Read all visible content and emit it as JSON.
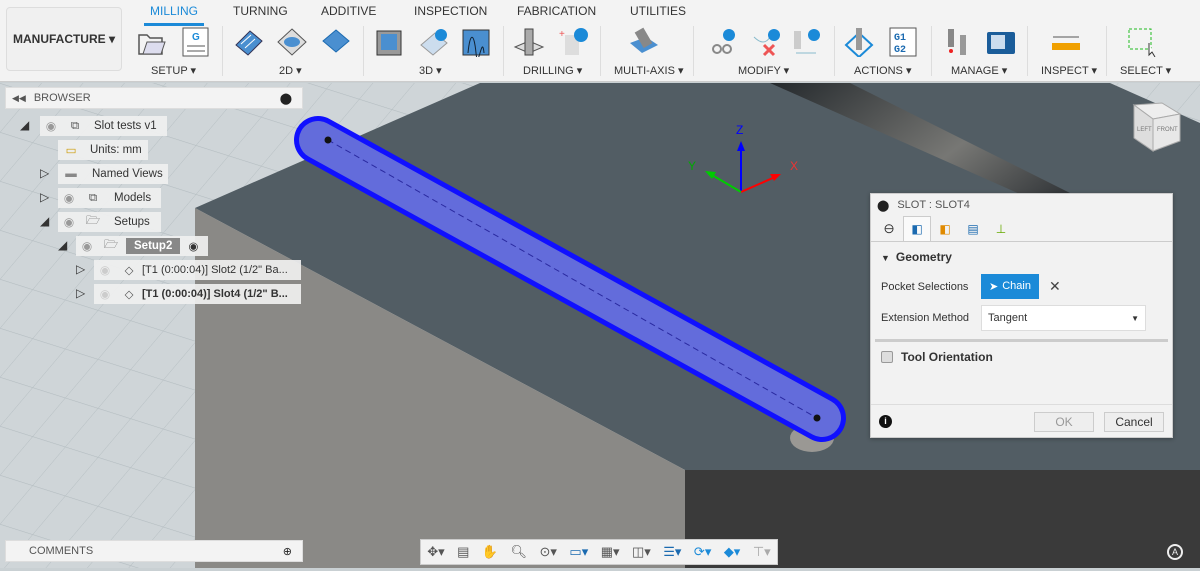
{
  "toolbar": {
    "workspace": "MANUFACTURE ▾",
    "tabs": [
      "MILLING",
      "TURNING",
      "ADDITIVE",
      "INSPECTION",
      "FABRICATION",
      "UTILITIES"
    ],
    "groups": [
      "SETUP ▾",
      "2D ▾",
      "3D ▾",
      "DRILLING ▾",
      "MULTI-AXIS ▾",
      "MODIFY ▾",
      "ACTIONS ▾",
      "MANAGE ▾",
      "INSPECT ▾",
      "SELECT ▾"
    ]
  },
  "browser": {
    "title": "BROWSER",
    "nodes": [
      "Slot tests v1",
      "Units: mm",
      "Named Views",
      "Models",
      "Setups",
      "Setup2",
      "[T1 (0:00:04)] Slot2 (1/2\" Ba...",
      "[T1 (0:00:04)] Slot4 (1/2\" B..."
    ]
  },
  "comments": {
    "title": "COMMENTS"
  },
  "axes": {
    "x": "X",
    "y": "Y",
    "z": "Z"
  },
  "viewcube": {
    "left": "LEFT",
    "front": "FRONT"
  },
  "dialog": {
    "title": "SLOT : SLOT4",
    "section": "Geometry",
    "pocket_label": "Pocket Selections",
    "chain_label": "Chain",
    "extension_label": "Extension Method",
    "extension_value": "Tangent",
    "tool_orientation": "Tool Orientation",
    "ok": "OK",
    "cancel": "Cancel"
  },
  "colors": {
    "accent": "#1b8ad8",
    "slot": "#1a1aff"
  }
}
